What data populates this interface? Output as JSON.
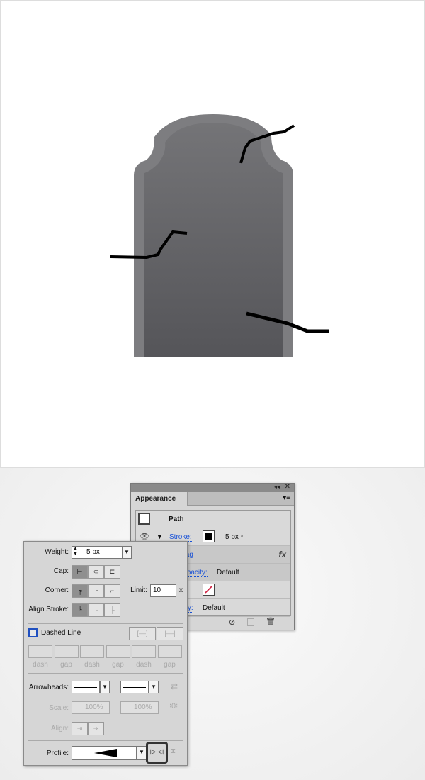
{
  "appearance": {
    "tab": "Appearance",
    "object": "Path",
    "stroke_label": "Stroke:",
    "stroke_value": "5 px *",
    "effect": "Zig Zag",
    "effect_icon": "fx",
    "opacity1_label": "Opacity:",
    "opacity1_value": "Default",
    "opacity2_label": "Opacity:",
    "opacity2_value": "Default"
  },
  "stroke_panel": {
    "weight_label": "Weight:",
    "weight_value": "5 px",
    "cap_label": "Cap:",
    "corner_label": "Corner:",
    "limit_label": "Limit:",
    "limit_value": "10",
    "limit_unit": "x",
    "align_label": "Align Stroke:",
    "dashed_label": "Dashed Line",
    "dash_labels": [
      "dash",
      "gap",
      "dash",
      "gap",
      "dash",
      "gap"
    ],
    "arrowheads_label": "Arrowheads:",
    "scale_label": "Scale:",
    "scale1": "100%",
    "scale2": "100%",
    "align_arrow_label": "Align:",
    "profile_label": "Profile:"
  },
  "colors": {
    "stone_outer": "#7c7c7e",
    "stone_inner": "#626265",
    "crack": "#000000",
    "link": "#1a53d8"
  }
}
